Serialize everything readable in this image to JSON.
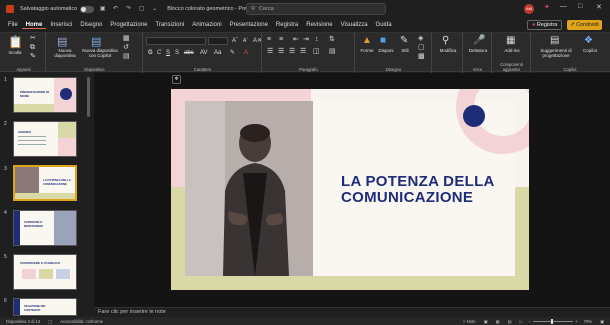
{
  "titlebar": {
    "autosave_label": "Salvataggio automatico",
    "doc_title": "Blocco colorato geometrico - PowerP...",
    "search_placeholder": "Cerca",
    "user_initials": "AM"
  },
  "menu": {
    "items": [
      "File",
      "Home",
      "Inserisci",
      "Disegno",
      "Progettazione",
      "Transizioni",
      "Animazioni",
      "Presentazione",
      "Registra",
      "Revisione",
      "Visualizza",
      "Guida"
    ],
    "active": "Home",
    "registra_button": "Registra",
    "share_button": "Condividi"
  },
  "ribbon": {
    "groups": {
      "appunti": "Appunti",
      "diapositive": "Diapositive",
      "carattere": "Carattere",
      "paragrafo": "Paragrafo",
      "disegno": "Disegno",
      "voce": "Voce",
      "componenti": "Componenti aggiuntivi",
      "copilot": "Copilot"
    },
    "buttons": {
      "incolla": "Incolla",
      "nuova_diapositiva": "Nuova diapositiva",
      "nuova_copilot": "Nuova diapositiva con Copilot",
      "forme": "Forme",
      "disponi": "Disponi",
      "stili": "Stili",
      "modifica": "Modifica",
      "dettatura": "Dettatura",
      "addins": "Add-ins",
      "suggerimenti": "Suggerimenti di progettazione",
      "copilot": "Copilot"
    },
    "font_size_value": ""
  },
  "thumbnails": [
    {
      "num": "1",
      "title": "PRESENTAZIONE DI MODE"
    },
    {
      "num": "2",
      "title": "AGENDA"
    },
    {
      "num": "3",
      "title": "LA POTENZA DELLA COMUNICAZIONE"
    },
    {
      "num": "4",
      "title": "SUPERARE IL NERVOSISMO"
    },
    {
      "num": "5",
      "title": "CONVINCERE IL PUBBLICO"
    },
    {
      "num": "6",
      "title": "SELEZIONE DEI CONTENUTI"
    }
  ],
  "slide": {
    "title_line1": "LA POTENZA DELLA",
    "title_line2": "COMUNICAZIONE"
  },
  "notes_placeholder": "Fare clic per inserire le note",
  "status": {
    "slide_counter": "Diapositiva 3 di 13",
    "accessibility": "Accessibilità: conforme",
    "notes": "Note",
    "zoom": "70%"
  },
  "colors": {
    "accent_orange": "#e06c4b",
    "share_yellow": "#e0a41a",
    "navy": "#1f2d78",
    "pink": "#f4d3d6",
    "olive": "#d8d9a6"
  }
}
